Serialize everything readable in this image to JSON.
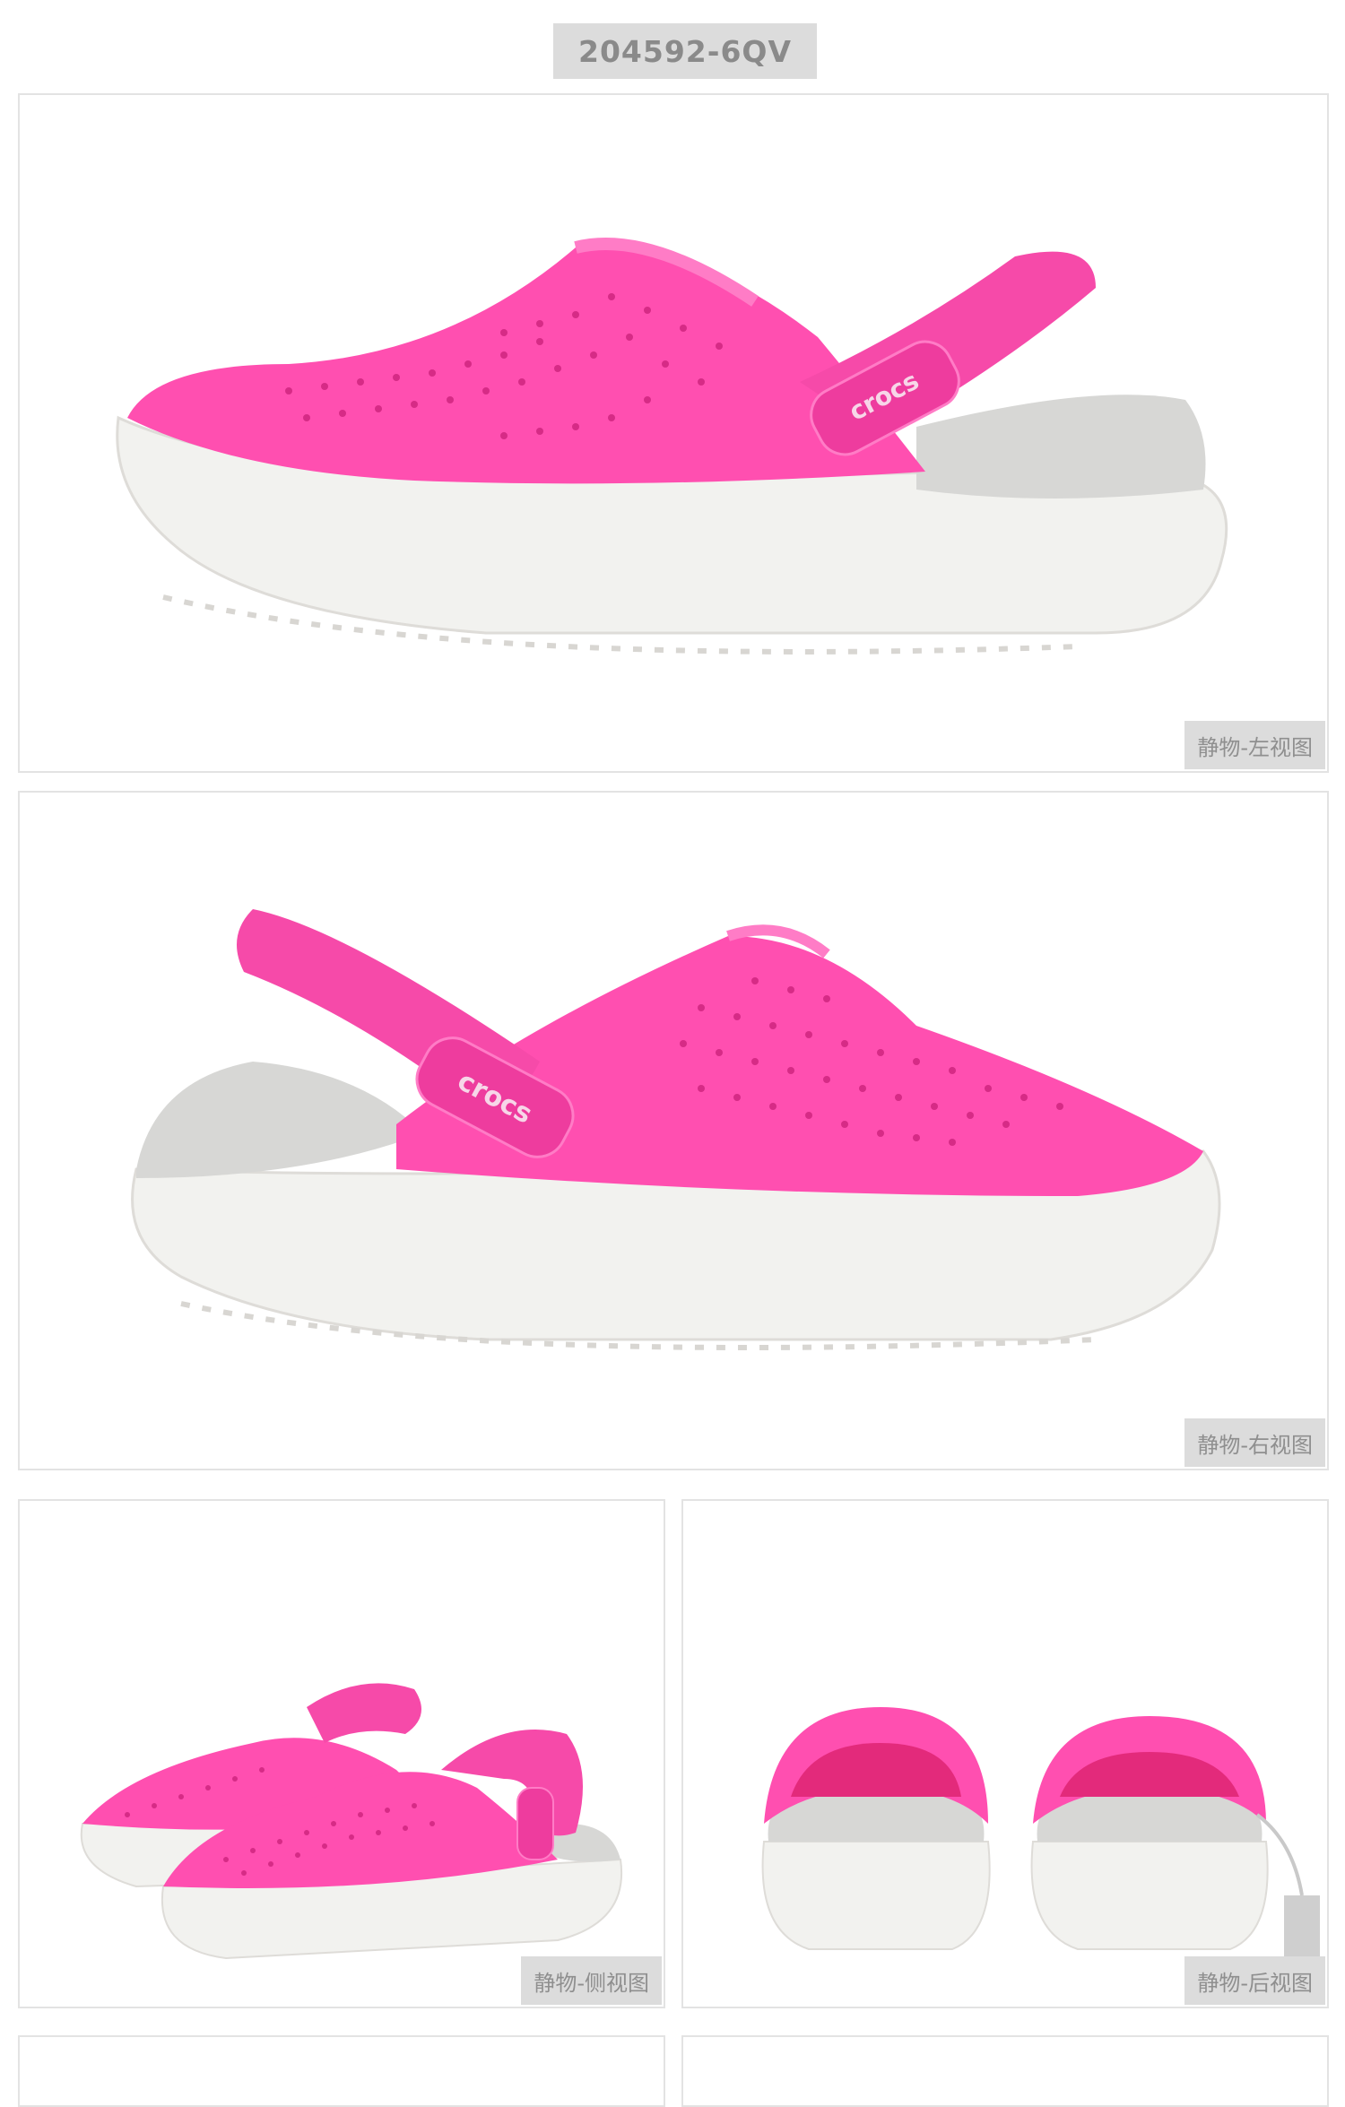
{
  "sku": "204592-6QV",
  "brand_logo_text": "crocs",
  "colors": {
    "pink": "#ff4fb0",
    "pink_dark": "#ee3c9e",
    "sole": "#f2f2ef",
    "liner": "#d7d7d5"
  },
  "views": [
    {
      "caption": "静物-左视图"
    },
    {
      "caption": "静物-右视图"
    },
    {
      "caption": "静物-侧视图"
    },
    {
      "caption": "静物-后视图"
    }
  ]
}
